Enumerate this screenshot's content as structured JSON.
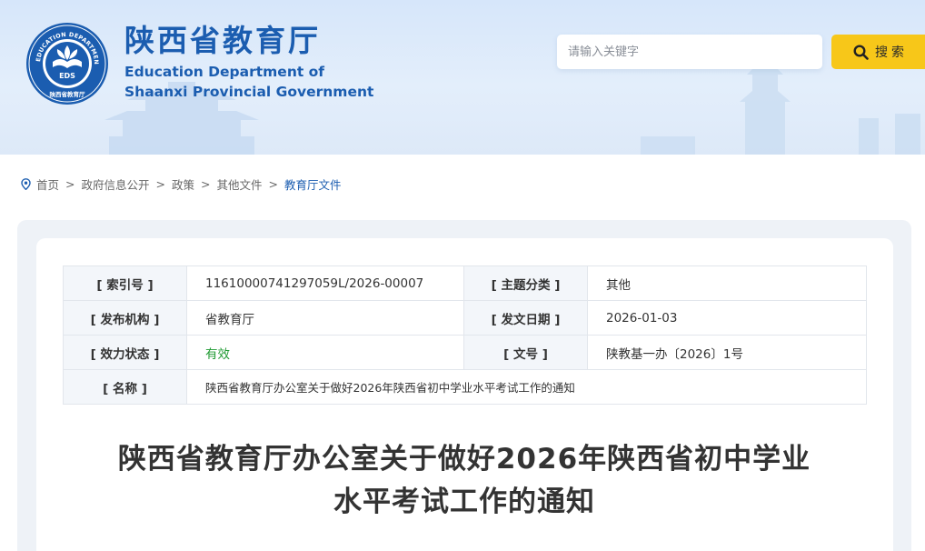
{
  "header": {
    "title_cn": "陕西省教育厅",
    "title_en_line1": "Education Department of",
    "title_en_line2": "Shaanxi Provincial Government",
    "emblem": {
      "ring_text": "EDUCATION DEPARTMENT OF SHAANXI",
      "center_text": "EDS",
      "bottom_text": "陕西省教育厅"
    },
    "search_placeholder": "请输入关键字",
    "search_button": "搜索",
    "colors": {
      "brand": "#1b5db0",
      "search_button": "#f7c719"
    }
  },
  "breadcrumb": {
    "items": [
      "首页",
      "政府信息公开",
      "政策",
      "其他文件",
      "教育厅文件"
    ],
    "separator": ">"
  },
  "info": {
    "rows": [
      {
        "k1": "[ 索引号 ]",
        "v1": "11610000741297059L/2026-00007",
        "k2": "[ 主题分类 ]",
        "v2": "其他"
      },
      {
        "k1": "[ 发布机构 ]",
        "v1": "省教育厅",
        "k2": "[ 发文日期 ]",
        "v2": "2026-01-03"
      },
      {
        "k1": "[ 效力状态 ]",
        "v1": "有效",
        "k2": "[ 文号 ]",
        "v2": "陕教基一办〔2026〕1号"
      }
    ],
    "name_key": "[ 名称 ]",
    "name_value": "陕西省教育厅办公室关于做好2026年陕西省初中学业水平考试工作的通知",
    "status_color": "#1f9a32"
  },
  "doc": {
    "title_line1": "陕西省教育厅办公室关于做好2026年陕西省初中学业",
    "title_line2": "水平考试工作的通知"
  }
}
